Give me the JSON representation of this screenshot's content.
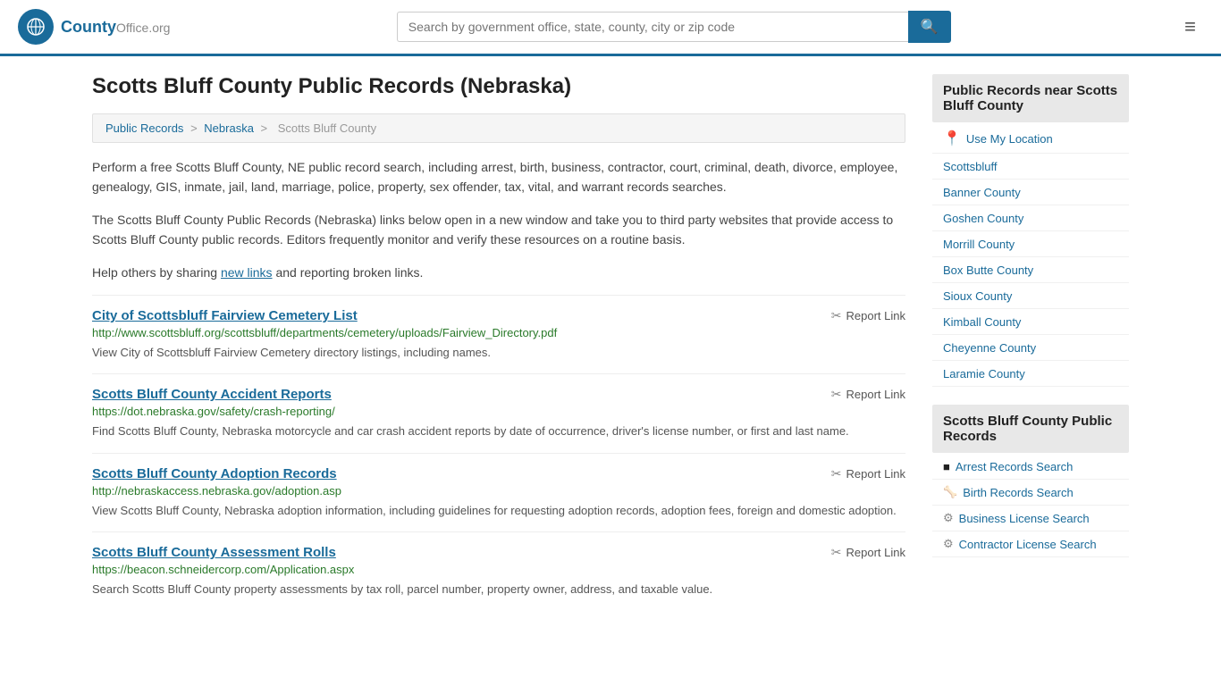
{
  "header": {
    "logo_text": "County",
    "logo_org": "Office.org",
    "search_placeholder": "Search by government office, state, county, city or zip code",
    "menu_icon": "≡"
  },
  "page": {
    "title": "Scotts Bluff County Public Records (Nebraska)",
    "breadcrumb": {
      "items": [
        "Public Records",
        "Nebraska",
        "Scotts Bluff County"
      ]
    },
    "description1": "Perform a free Scotts Bluff County, NE public record search, including arrest, birth, business, contractor, court, criminal, death, divorce, employee, genealogy, GIS, inmate, jail, land, marriage, police, property, sex offender, tax, vital, and warrant records searches.",
    "description2": "The Scotts Bluff County Public Records (Nebraska) links below open in a new window and take you to third party websites that provide access to Scotts Bluff County public records. Editors frequently monitor and verify these resources on a routine basis.",
    "description3": "Help others by sharing",
    "new_links": "new links",
    "description3b": "and reporting broken links."
  },
  "records": [
    {
      "title": "City of Scottsbluff Fairview Cemetery List",
      "url": "http://www.scottsbluff.org/scottsbluff/departments/cemetery/uploads/Fairview_Directory.pdf",
      "desc": "View City of Scottsbluff Fairview Cemetery directory listings, including names.",
      "report": "Report Link"
    },
    {
      "title": "Scotts Bluff County Accident Reports",
      "url": "https://dot.nebraska.gov/safety/crash-reporting/",
      "desc": "Find Scotts Bluff County, Nebraska motorcycle and car crash accident reports by date of occurrence, driver's license number, or first and last name.",
      "report": "Report Link"
    },
    {
      "title": "Scotts Bluff County Adoption Records",
      "url": "http://nebraskaccess.nebraska.gov/adoption.asp",
      "desc": "View Scotts Bluff County, Nebraska adoption information, including guidelines for requesting adoption records, adoption fees, foreign and domestic adoption.",
      "report": "Report Link"
    },
    {
      "title": "Scotts Bluff County Assessment Rolls",
      "url": "https://beacon.schneidercorp.com/Application.aspx",
      "desc": "Search Scotts Bluff County property assessments by tax roll, parcel number, property owner, address, and taxable value.",
      "report": "Report Link"
    }
  ],
  "sidebar": {
    "nearby_header": "Public Records near Scotts Bluff County",
    "use_location": "Use My Location",
    "nearby_links": [
      "Scottsbluff",
      "Banner County",
      "Goshen County",
      "Morrill County",
      "Box Butte County",
      "Sioux County",
      "Kimball County",
      "Cheyenne County",
      "Laramie County"
    ],
    "records_header": "Scotts Bluff County Public Records",
    "records_links": [
      {
        "label": "Arrest Records Search",
        "icon": "■"
      },
      {
        "label": "Birth Records Search",
        "icon": "👤"
      },
      {
        "label": "Business License Search",
        "icon": "⚙"
      },
      {
        "label": "Contractor License Search",
        "icon": "⚙"
      }
    ]
  }
}
